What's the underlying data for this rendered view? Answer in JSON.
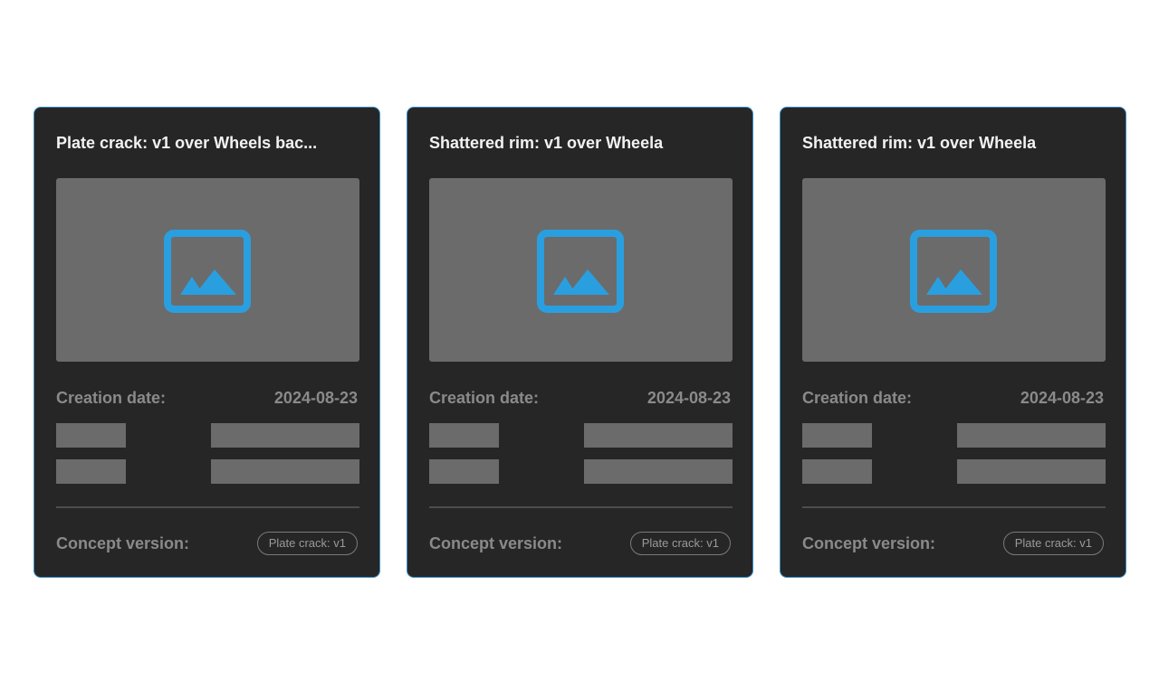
{
  "colors": {
    "card_background": "#262626",
    "card_border": "#3a8fc6",
    "placeholder": "#6b6b6b",
    "image_icon": "#2a9fe0",
    "label_text": "#8a8a8a"
  },
  "cards": [
    {
      "title": "Plate crack: v1 over Wheels bac...",
      "image_icon": "image-placeholder-icon",
      "creation_date_label": "Creation date:",
      "creation_date_value": "2024-08-23",
      "concept_version_label": "Concept version:",
      "concept_version_badge": "Plate crack: v1"
    },
    {
      "title": "Shattered rim: v1 over Wheela",
      "image_icon": "image-placeholder-icon",
      "creation_date_label": "Creation date:",
      "creation_date_value": "2024-08-23",
      "concept_version_label": "Concept version:",
      "concept_version_badge": "Plate crack: v1"
    },
    {
      "title": "Shattered rim: v1 over Wheela",
      "image_icon": "image-placeholder-icon",
      "creation_date_label": "Creation date:",
      "creation_date_value": "2024-08-23",
      "concept_version_label": "Concept version:",
      "concept_version_badge": "Plate crack: v1"
    }
  ]
}
